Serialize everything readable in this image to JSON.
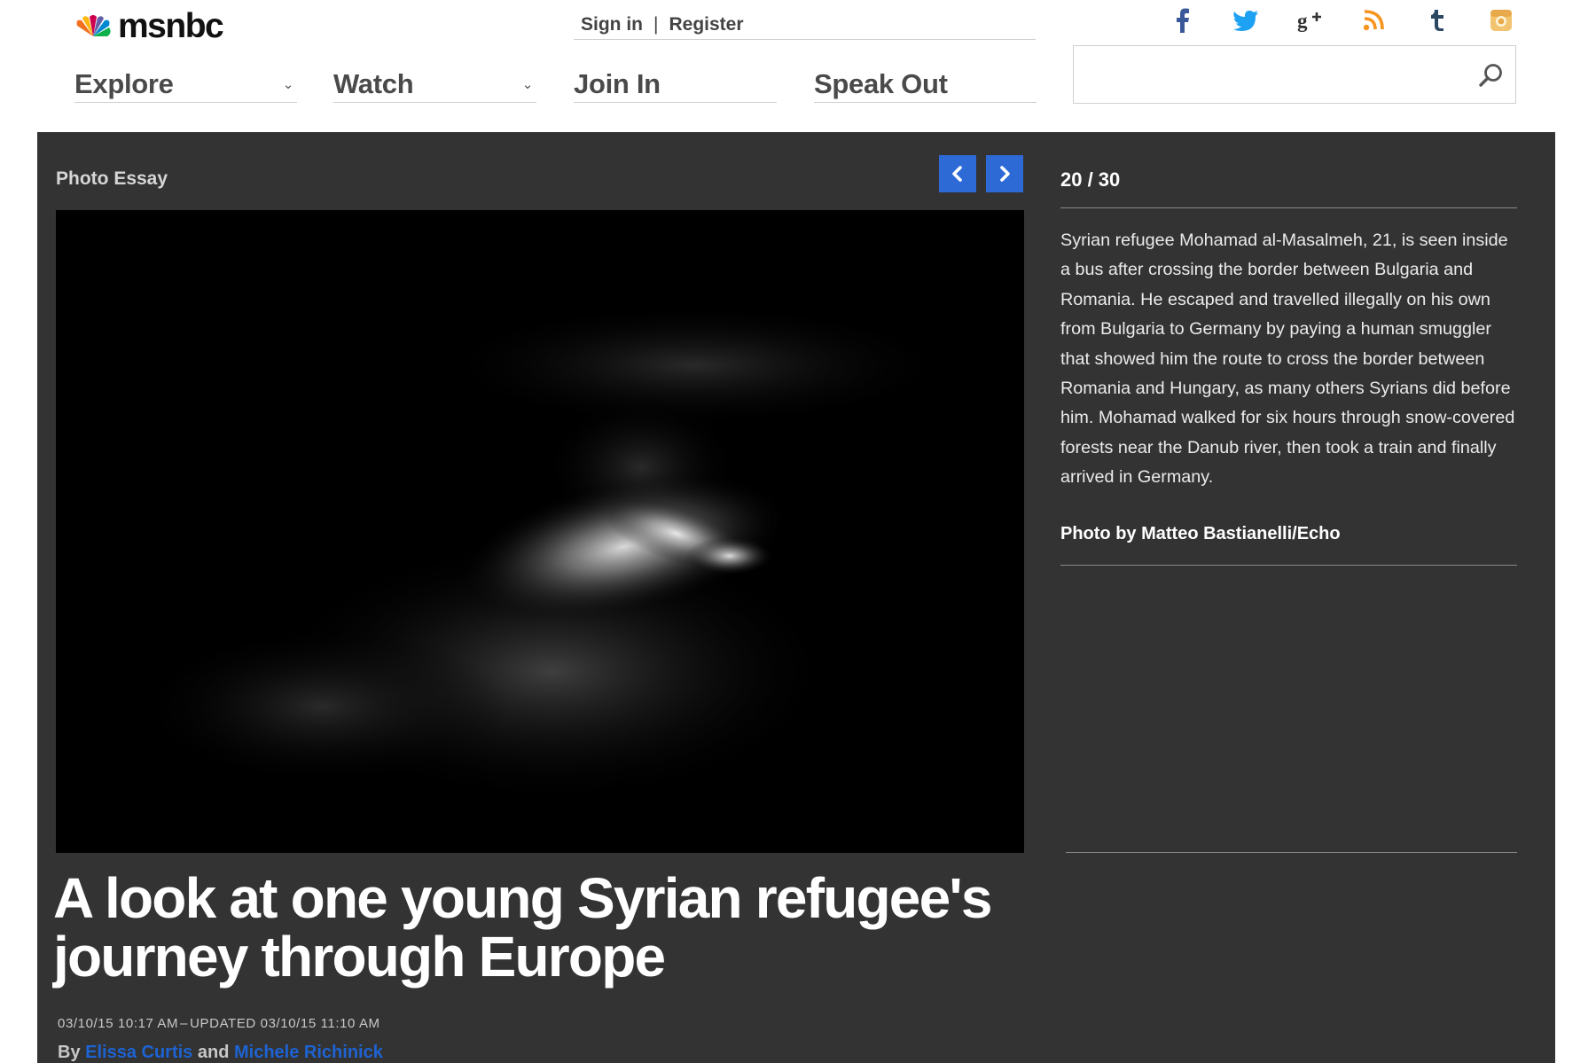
{
  "brand": {
    "logo_text": "msnbc"
  },
  "account": {
    "signin_label": "Sign in",
    "separator": "|",
    "register_label": "Register"
  },
  "social": [
    {
      "icon": "facebook-icon",
      "glyph": "f",
      "color": "#3b5998"
    },
    {
      "icon": "twitter-icon",
      "glyph": "t-bird",
      "color": "#1da1f2"
    },
    {
      "icon": "google-plus-icon",
      "glyph": "g+",
      "color": "#333333"
    },
    {
      "icon": "rss-icon",
      "glyph": "rss",
      "color": "#f7941e"
    },
    {
      "icon": "tumblr-icon",
      "glyph": "t",
      "color": "#2c4762"
    },
    {
      "icon": "instagram-icon",
      "glyph": "cam",
      "color": "#f2c46f"
    }
  ],
  "nav": [
    {
      "label": "Explore",
      "has_dropdown": true
    },
    {
      "label": "Watch",
      "has_dropdown": true
    },
    {
      "label": "Join In",
      "has_dropdown": false
    },
    {
      "label": "Speak Out",
      "has_dropdown": false
    }
  ],
  "search": {
    "value": "",
    "placeholder": ""
  },
  "gallery": {
    "kicker": "Photo Essay",
    "counter": "20 / 30",
    "current": 20,
    "total": 30,
    "caption": "Syrian refugee Mohamad al-Masalmeh, 21, is seen inside a bus after crossing the border between Bulgaria and Romania. He escaped and travelled illegally on his own from Bulgaria to Germany by paying a human smuggler that showed him the route to cross the border between Romania and Hungary, as many others Syrians did before him. Mohamad walked for six hours through snow-covered forests near the Danub river, then took a train and finally arrived in Germany.",
    "credit": "Photo by Matteo Bastianelli/Echo"
  },
  "article": {
    "headline": "A look at one young Syrian refugee's journey through Europe",
    "published": "03/10/15 10:17 AM",
    "dash": "–",
    "updated": "UPDATED 03/10/15 11:10 AM",
    "by_label": "By",
    "and_label": "and",
    "authors": [
      "Elissa Curtis",
      "Michele Richinick"
    ]
  },
  "colors": {
    "panel": "#333333",
    "accent": "#2d6ad6",
    "author_link": "#1d63d3"
  }
}
